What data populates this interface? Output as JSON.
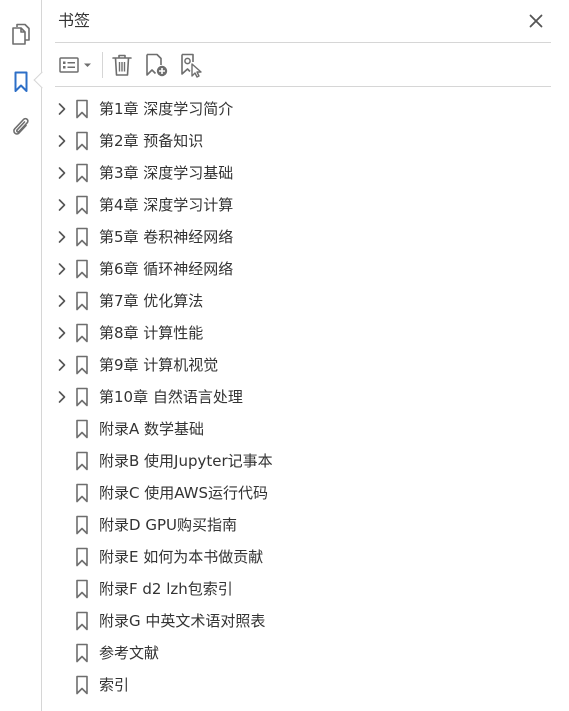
{
  "panel": {
    "title": "书签"
  },
  "colors": {
    "accent": "#2d6fc7",
    "icon": "#6e6e6e",
    "text": "#333333",
    "divider": "#d6d6d6"
  },
  "left_rail": {
    "items": [
      {
        "icon": "pages-icon",
        "active": false
      },
      {
        "icon": "bookmark-icon",
        "active": true
      },
      {
        "icon": "attachment-icon",
        "active": false
      }
    ]
  },
  "toolbar": {
    "items": [
      {
        "icon": "options-menu-icon"
      },
      {
        "icon": "trash-icon"
      },
      {
        "icon": "new-bookmark-icon"
      },
      {
        "icon": "bookmark-settings-icon"
      }
    ]
  },
  "bookmarks": [
    {
      "label": "第1章 深度学习简介",
      "expandable": true
    },
    {
      "label": "第2章 预备知识",
      "expandable": true
    },
    {
      "label": "第3章 深度学习基础",
      "expandable": true
    },
    {
      "label": "第4章 深度学习计算",
      "expandable": true
    },
    {
      "label": "第5章 卷积神经网络",
      "expandable": true
    },
    {
      "label": "第6章 循环神经网络",
      "expandable": true
    },
    {
      "label": "第7章 优化算法",
      "expandable": true
    },
    {
      "label": "第8章 计算性能",
      "expandable": true
    },
    {
      "label": "第9章 计算机视觉",
      "expandable": true
    },
    {
      "label": "第10章 自然语言处理",
      "expandable": true
    },
    {
      "label": "附录A 数学基础",
      "expandable": false
    },
    {
      "label": "附录B 使用Jupyter记事本",
      "expandable": false
    },
    {
      "label": "附录C 使用AWS运行代码",
      "expandable": false
    },
    {
      "label": "附录D GPU购买指南",
      "expandable": false
    },
    {
      "label": "附录E 如何为本书做贡献",
      "expandable": false
    },
    {
      "label": "附录F d2 lzh包索引",
      "expandable": false
    },
    {
      "label": "附录G 中英文术语对照表",
      "expandable": false
    },
    {
      "label": "参考文献",
      "expandable": false
    },
    {
      "label": "索引",
      "expandable": false
    }
  ]
}
